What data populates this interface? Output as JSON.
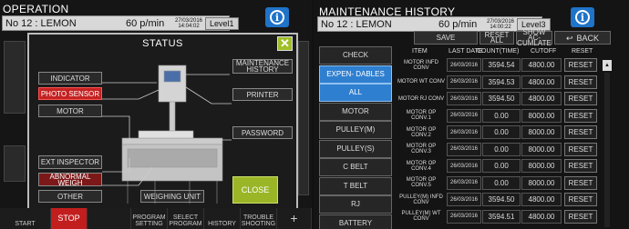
{
  "left": {
    "title": "OPERATION",
    "product": "No 12 : LEMON",
    "speed": "60 p/min",
    "date": "27/03/2016",
    "time": "14:04:02",
    "level": "Level1",
    "bottom_buttons": {
      "start": "START",
      "stop": "STOP",
      "program_setting": "PROGRAM SETTING",
      "select_program": "SELECT PROGRAM",
      "history": "HISTORY",
      "trouble_shooting": "TROUBLE SHOOTING"
    },
    "status_dialog": {
      "title": "STATUS",
      "indicator": "INDICATOR",
      "photo_sensor": "PHOTO SENSOR",
      "motor": "MOTOR",
      "ext_inspector": "EXT INSPECTOR",
      "abnormal_weigh": "ABNORMAL WEIGH",
      "other": "OTHER",
      "weighing_unit": "WEIGHING UNIT",
      "maintenance_history": "MAINTENANCE HISTORY",
      "printer": "PRINTER",
      "password": "PASSWORD",
      "close": "CLOSE"
    }
  },
  "right": {
    "title": "MAINTENANCE HISTORY",
    "product": "No 12 : LEMON",
    "speed": "60 p/min",
    "date": "27/03/2016",
    "time": "14:00:22",
    "level": "Level3",
    "toolbar": {
      "save": "SAVE",
      "reset_all": "RESET ALL",
      "show_accumulate": "SHOW AC- CUMLATE",
      "back": "BACK"
    },
    "categories": [
      {
        "label": "CHECK",
        "style": "dark"
      },
      {
        "label": "EXPEN- DABLES",
        "style": "blue"
      },
      {
        "label": "ALL",
        "style": "blue"
      },
      {
        "label": "MOTOR",
        "style": "dark"
      },
      {
        "label": "PULLEY(M)",
        "style": "dark"
      },
      {
        "label": "PULLEY(S)",
        "style": "dark"
      },
      {
        "label": "C BELT",
        "style": "dark"
      },
      {
        "label": "T BELT",
        "style": "dark"
      },
      {
        "label": "RJ",
        "style": "dark"
      },
      {
        "label": "BATTERY",
        "style": "dark"
      }
    ],
    "columns": {
      "item": "ITEM",
      "last_date": "LAST DATE",
      "count": "COUNT(TIME)",
      "cutoff": "CUTOFF",
      "reset": "RESET"
    },
    "rows": [
      {
        "item": "MOTOR INFD CONV",
        "date": "26/03/2016",
        "count": "3594.54",
        "cutoff": "4800.00",
        "reset": "RESET"
      },
      {
        "item": "MOTOR WT CONV",
        "date": "26/03/2016",
        "count": "3594.53",
        "cutoff": "4800.00",
        "reset": "RESET"
      },
      {
        "item": "MOTOR RJ CONV",
        "date": "26/03/2016",
        "count": "3594.50",
        "cutoff": "4800.00",
        "reset": "RESET"
      },
      {
        "item": "MOTOR OP CONV.1",
        "date": "26/03/2016",
        "count": "0.00",
        "cutoff": "8000.00",
        "reset": "RESET"
      },
      {
        "item": "MOTOR OP CONV.2",
        "date": "26/03/2016",
        "count": "0.00",
        "cutoff": "8000.00",
        "reset": "RESET"
      },
      {
        "item": "MOTOR OP CONV.3",
        "date": "26/03/2016",
        "count": "0.00",
        "cutoff": "8000.00",
        "reset": "RESET"
      },
      {
        "item": "MOTOR OP CONV.4",
        "date": "26/03/2016",
        "count": "0.00",
        "cutoff": "8000.00",
        "reset": "RESET"
      },
      {
        "item": "MOTOR OP CONV.5",
        "date": "26/03/2016",
        "count": "0.00",
        "cutoff": "8000.00",
        "reset": "RESET"
      },
      {
        "item": "PULLEY(M) INFD CONV",
        "date": "26/03/2016",
        "count": "3594.50",
        "cutoff": "4800.00",
        "reset": "RESET"
      },
      {
        "item": "PULLEY(M) WT CONV",
        "date": "26/03/2016",
        "count": "3594.51",
        "cutoff": "4800.00",
        "reset": "RESET"
      }
    ]
  }
}
